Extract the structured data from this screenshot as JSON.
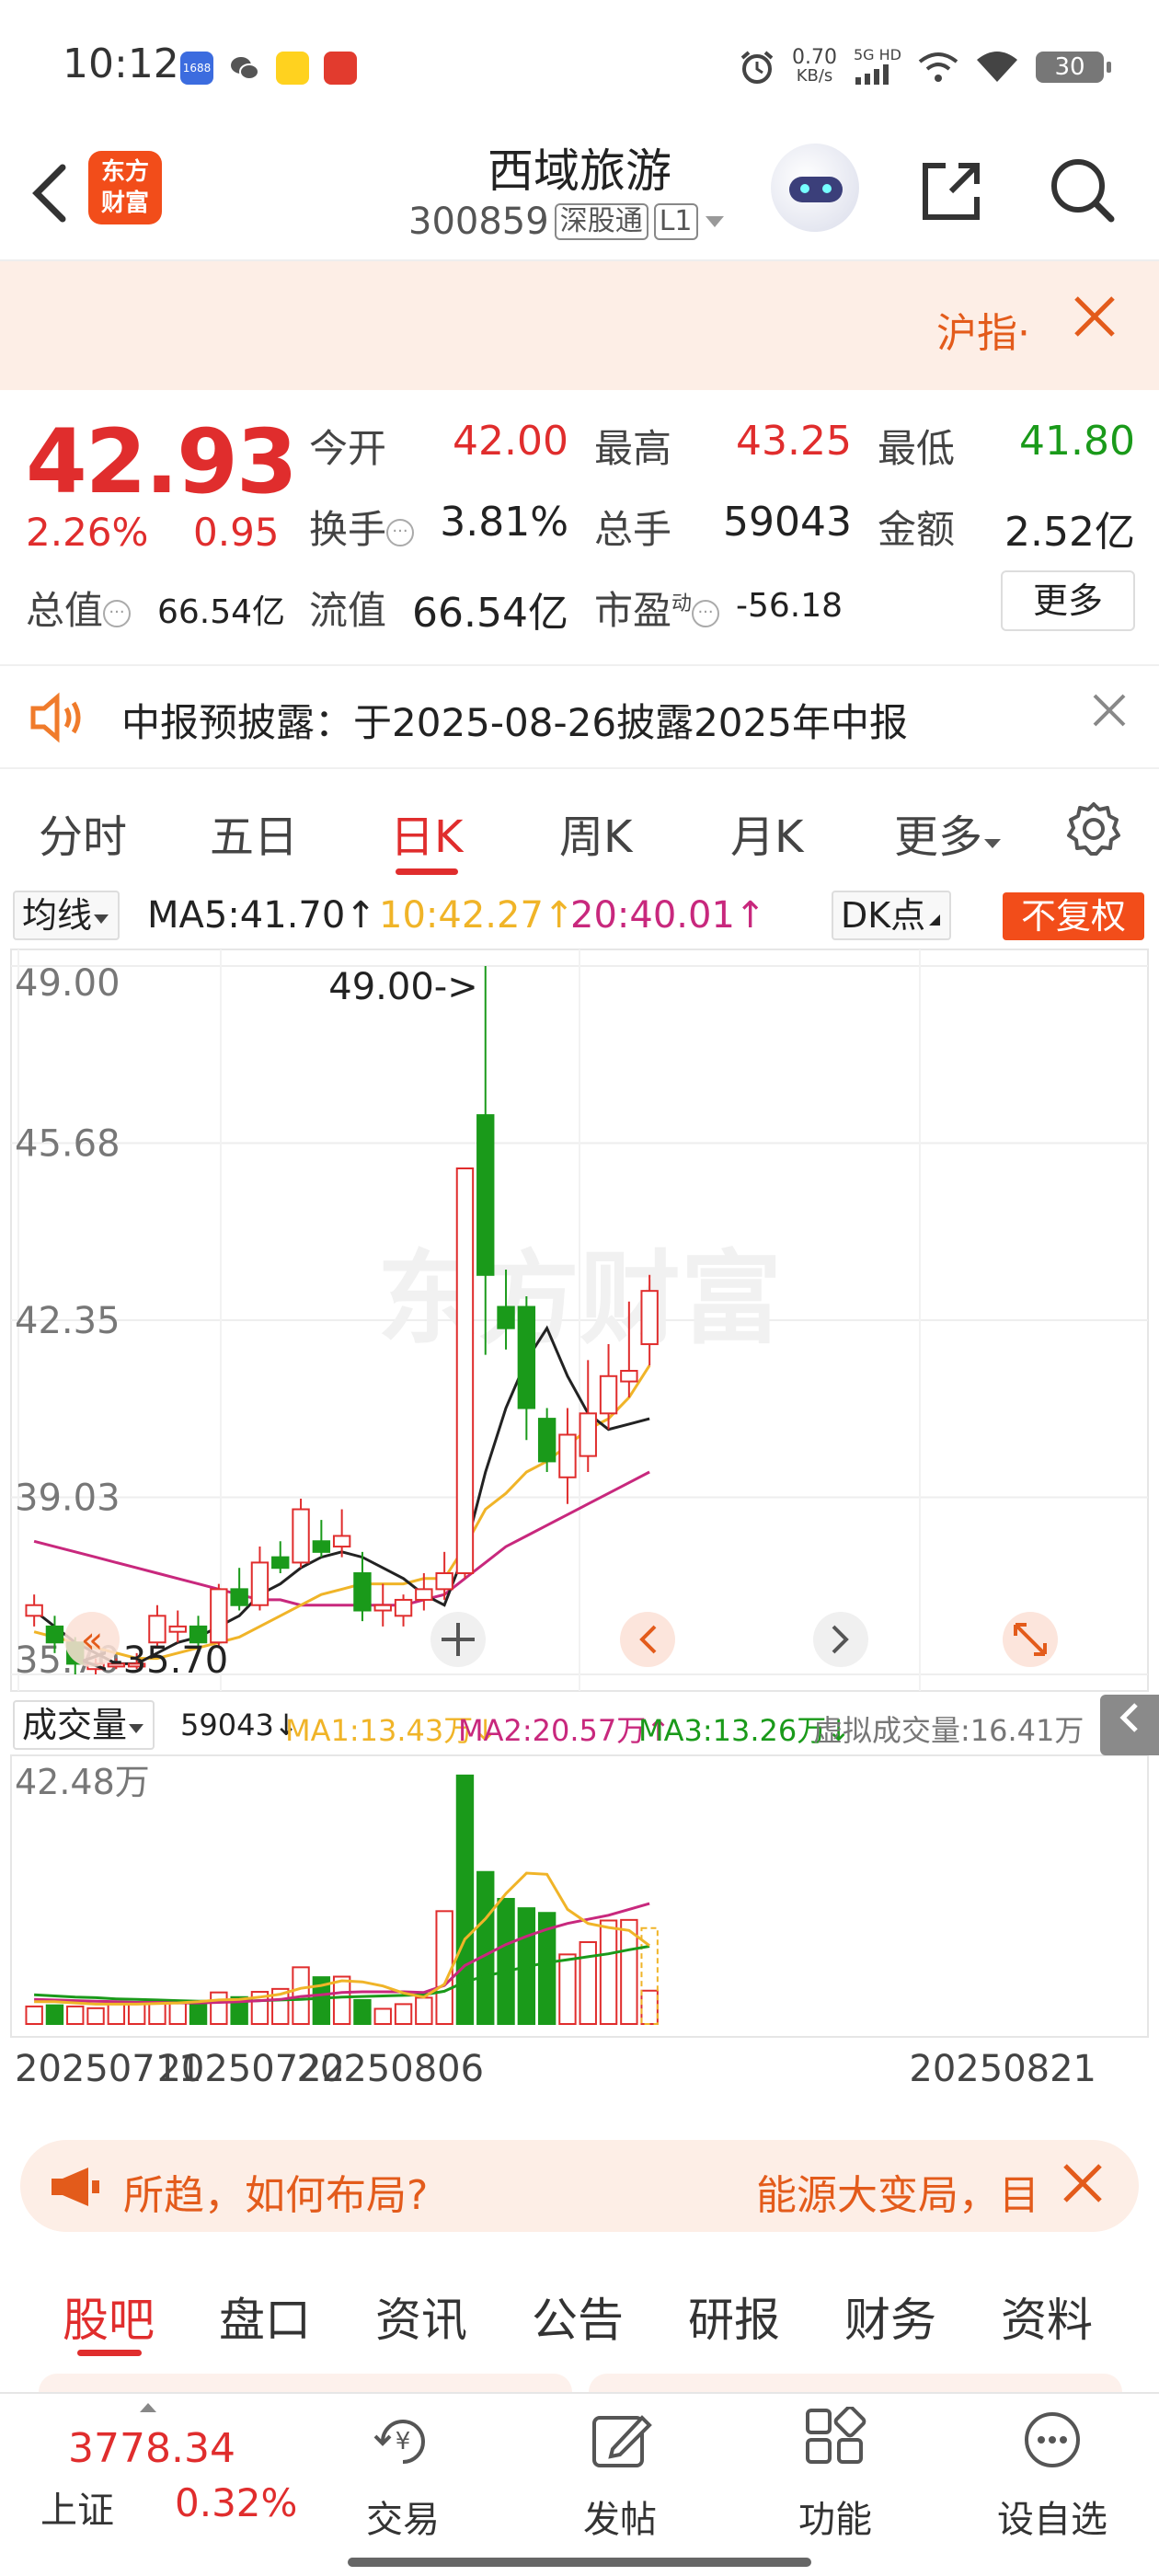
{
  "status_bar": {
    "time": "10:12",
    "net_speed_value": "0.70",
    "net_speed_unit": "KB/s",
    "signal_label": "5G HD",
    "battery": "30",
    "apps": [
      "1688",
      "wechat-icon",
      "taobao-icon",
      "red-app-icon"
    ]
  },
  "header": {
    "stock_name": "西域旅游",
    "stock_code": "300859",
    "connect_tag": "深股通",
    "level_tag": "L1",
    "logo_line1": "东方",
    "logo_line2": "财富"
  },
  "banner": {
    "text": "沪指·"
  },
  "quote": {
    "price": "42.93",
    "change_pct": "2.26%",
    "change": "0.95",
    "open_label": "今开",
    "open": "42.00",
    "high_label": "最高",
    "high": "43.25",
    "low_label": "最低",
    "low": "41.80",
    "turnover_label": "换手",
    "turnover": "3.81%",
    "volume_label": "总手",
    "volume": "59043",
    "amount_label": "金额",
    "amount": "2.52亿",
    "mktcap_label": "总值",
    "mktcap": "66.54亿",
    "float_label": "流值",
    "float_cap": "66.54亿",
    "pe_label": "市盈",
    "pe_sup": "动",
    "pe": "-56.18",
    "more_button": "更多"
  },
  "notice": {
    "text": "中报预披露：于2025-08-26披露2025年中报"
  },
  "period_tabs": {
    "items": [
      "分时",
      "五日",
      "日K",
      "周K",
      "月K",
      "更多"
    ],
    "active": "日K"
  },
  "chart_toolbar": {
    "indicator_select": "均线",
    "ma5": "MA5:41.70↑",
    "ma10": "10:42.27↑",
    "ma20": "20:40.01↑",
    "dk_select": "DK点",
    "fuquan_button": "不复权"
  },
  "volume_toolbar": {
    "indicator_select": "成交量",
    "vol": "59043↓",
    "ma1": "MA1:13.43万↓",
    "ma2": "MA2:20.57万↑",
    "ma3": "MA3:13.26万↓",
    "virtual": "虚拟成交量:16.41万"
  },
  "colors": {
    "up": "#e02d2d",
    "down": "#1a9a1a",
    "brand": "#f24d1a",
    "ma5": "#222222",
    "ma10": "#f0b428",
    "ma20": "#c8287d"
  },
  "chart_data": [
    {
      "type": "candlestick",
      "title": "",
      "y_ticks": [
        "49.00",
        "45.68",
        "42.35",
        "39.03",
        "35.70"
      ],
      "ylim": [
        35.7,
        49.0
      ],
      "high_annotation": "49.00->",
      "low_annotation": "<-35.70",
      "watermark": "东方财富",
      "candles": [
        {
          "o": 36.8,
          "c": 37.0,
          "h": 37.2,
          "l": 36.6
        },
        {
          "o": 36.6,
          "c": 36.3,
          "h": 36.8,
          "l": 36.1
        },
        {
          "o": 36.3,
          "c": 35.9,
          "h": 36.4,
          "l": 35.7
        },
        {
          "o": 35.8,
          "c": 35.9,
          "h": 36.0,
          "l": 35.7
        },
        {
          "o": 35.9,
          "c": 35.9,
          "h": 36.0,
          "l": 35.8
        },
        {
          "o": 35.9,
          "c": 35.9,
          "h": 36.1,
          "l": 35.8
        },
        {
          "o": 36.3,
          "c": 36.8,
          "h": 37.0,
          "l": 36.2
        },
        {
          "o": 36.5,
          "c": 36.6,
          "h": 36.9,
          "l": 36.3
        },
        {
          "o": 36.6,
          "c": 36.3,
          "h": 36.8,
          "l": 36.2
        },
        {
          "o": 36.3,
          "c": 37.3,
          "h": 37.4,
          "l": 36.2
        },
        {
          "o": 37.3,
          "c": 37.0,
          "h": 37.7,
          "l": 36.9
        },
        {
          "o": 37.0,
          "c": 37.8,
          "h": 38.1,
          "l": 36.9
        },
        {
          "o": 37.9,
          "c": 37.7,
          "h": 38.2,
          "l": 37.6
        },
        {
          "o": 37.8,
          "c": 38.8,
          "h": 39.0,
          "l": 37.7
        },
        {
          "o": 38.2,
          "c": 38.0,
          "h": 38.6,
          "l": 37.9
        },
        {
          "o": 38.1,
          "c": 38.3,
          "h": 38.8,
          "l": 37.9
        },
        {
          "o": 37.6,
          "c": 36.9,
          "h": 38.0,
          "l": 36.7
        },
        {
          "o": 36.9,
          "c": 37.0,
          "h": 37.4,
          "l": 36.6
        },
        {
          "o": 36.8,
          "c": 37.1,
          "h": 37.2,
          "l": 36.6
        },
        {
          "o": 37.1,
          "c": 37.3,
          "h": 37.6,
          "l": 36.9
        },
        {
          "o": 37.3,
          "c": 37.6,
          "h": 38.0,
          "l": 37.1
        },
        {
          "o": 37.6,
          "c": 45.2,
          "h": 45.2,
          "l": 37.5
        },
        {
          "o": 46.2,
          "c": 43.2,
          "h": 49.0,
          "l": 41.7
        },
        {
          "o": 42.6,
          "c": 42.2,
          "h": 43.3,
          "l": 41.8
        },
        {
          "o": 42.6,
          "c": 40.7,
          "h": 42.8,
          "l": 40.1
        },
        {
          "o": 40.5,
          "c": 39.7,
          "h": 40.7,
          "l": 39.5
        },
        {
          "o": 39.4,
          "c": 40.2,
          "h": 40.7,
          "l": 38.9
        },
        {
          "o": 39.8,
          "c": 40.6,
          "h": 41.6,
          "l": 39.5
        },
        {
          "o": 40.6,
          "c": 41.3,
          "h": 41.9,
          "l": 40.3
        },
        {
          "o": 41.2,
          "c": 41.4,
          "h": 42.7,
          "l": 40.9
        },
        {
          "o": 41.9,
          "c": 42.9,
          "h": 43.2,
          "l": 41.5
        }
      ],
      "ma5": [
        36.9,
        36.6,
        36.3,
        36.1,
        35.9,
        35.9,
        36.1,
        36.3,
        36.4,
        36.6,
        36.8,
        37.2,
        37.4,
        37.7,
        37.9,
        38.0,
        37.9,
        37.7,
        37.5,
        37.2,
        37.0,
        38.0,
        39.5,
        40.7,
        41.6,
        42.2,
        41.3,
        40.6,
        40.3,
        40.4,
        40.5
      ],
      "ma10": [
        36.5,
        36.4,
        36.3,
        36.2,
        36.1,
        36.0,
        36.0,
        36.1,
        36.2,
        36.3,
        36.4,
        36.6,
        36.8,
        37.0,
        37.2,
        37.3,
        37.4,
        37.4,
        37.4,
        37.5,
        37.5,
        38.1,
        38.8,
        39.1,
        39.5,
        39.7,
        40.0,
        40.3,
        40.5,
        40.9,
        41.5
      ],
      "ma20": [
        38.2,
        38.1,
        38.0,
        37.9,
        37.8,
        37.7,
        37.6,
        37.5,
        37.4,
        37.3,
        37.2,
        37.1,
        37.1,
        37.0,
        37.0,
        37.0,
        37.0,
        37.0,
        37.0,
        37.1,
        37.2,
        37.5,
        37.8,
        38.1,
        38.3,
        38.5,
        38.7,
        38.9,
        39.1,
        39.3,
        39.5
      ]
    },
    {
      "type": "bar",
      "title": "",
      "y_max_label": "42.48万",
      "ylim": [
        0,
        42.48
      ],
      "x_ticks": [
        "20250711",
        "20250722",
        "20250806",
        "20250821"
      ],
      "volumes": [
        3.0,
        3.2,
        3.0,
        2.7,
        3.7,
        3.6,
        3.8,
        3.7,
        3.6,
        5.4,
        4.6,
        5.5,
        6.0,
        9.7,
        8.0,
        8.1,
        4.1,
        2.6,
        3.4,
        4.5,
        19.3,
        42.5,
        26.0,
        21.4,
        19.8,
        19.0,
        11.9,
        14.0,
        17.7,
        17.8,
        5.7
      ],
      "up_flags": [
        true,
        false,
        true,
        true,
        true,
        true,
        true,
        true,
        false,
        true,
        false,
        true,
        true,
        true,
        false,
        true,
        false,
        true,
        true,
        true,
        true,
        false,
        false,
        false,
        false,
        false,
        true,
        true,
        true,
        true,
        true
      ],
      "ma1": [
        3.8,
        3.8,
        3.6,
        3.4,
        3.4,
        3.4,
        3.5,
        3.6,
        3.8,
        4.1,
        4.2,
        4.6,
        5.1,
        6.1,
        6.6,
        7.4,
        7.2,
        6.5,
        5.3,
        4.6,
        6.8,
        14.5,
        18.0,
        22.3,
        25.8,
        25.6,
        19.6,
        17.2,
        16.5,
        16.0,
        13.4
      ],
      "ma2": [
        4.2,
        4.1,
        4.0,
        3.9,
        3.8,
        3.7,
        3.7,
        3.6,
        3.6,
        3.7,
        3.8,
        4.0,
        4.2,
        4.7,
        5.0,
        5.4,
        5.5,
        5.5,
        5.5,
        5.4,
        6.6,
        10.0,
        11.8,
        13.6,
        15.0,
        16.2,
        17.2,
        17.9,
        18.6,
        19.6,
        20.6
      ],
      "ma3": [
        5.0,
        4.8,
        4.6,
        4.5,
        4.3,
        4.2,
        4.1,
        4.0,
        3.9,
        3.9,
        3.9,
        4.0,
        4.1,
        4.2,
        4.4,
        4.6,
        4.7,
        4.8,
        4.9,
        5.0,
        5.6,
        7.2,
        8.2,
        9.0,
        9.8,
        10.5,
        11.0,
        11.5,
        12.0,
        12.7,
        13.3
      ]
    }
  ],
  "promo": {
    "text_left": "所趋，如何布局?",
    "text_right": "能源大变局，目"
  },
  "info_tabs": {
    "items": [
      "股吧",
      "盘口",
      "资讯",
      "公告",
      "研报",
      "财务",
      "资料"
    ],
    "active": "股吧"
  },
  "bottom_nav": {
    "index_value": "3778.34",
    "index_name": "上证",
    "index_pct": "0.32%",
    "items": [
      {
        "label": "交易",
        "icon": "trade-icon"
      },
      {
        "label": "发帖",
        "icon": "post-icon"
      },
      {
        "label": "功能",
        "icon": "grid-icon"
      },
      {
        "label": "设自选",
        "icon": "more-dots-icon"
      }
    ]
  }
}
